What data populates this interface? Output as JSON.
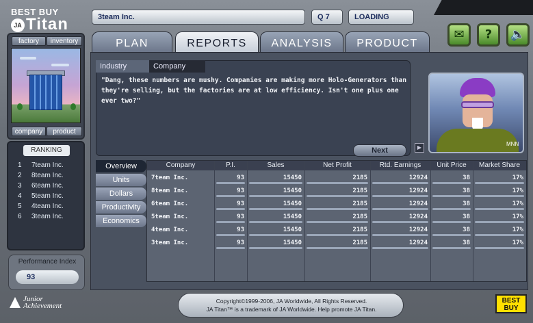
{
  "brand": {
    "store": "BEST BUY",
    "ja_badge": "JA",
    "product": "Titan"
  },
  "left_tabs": {
    "factory": "factory",
    "inventory": "inventory",
    "company": "company",
    "product": "product"
  },
  "ranking": {
    "title": "RANKING",
    "items": [
      {
        "n": "1",
        "name": "7team Inc."
      },
      {
        "n": "2",
        "name": "8team Inc."
      },
      {
        "n": "3",
        "name": "6team Inc."
      },
      {
        "n": "4",
        "name": "5team Inc."
      },
      {
        "n": "5",
        "name": "4team Inc."
      },
      {
        "n": "6",
        "name": "3team Inc."
      }
    ]
  },
  "performance": {
    "label": "Performance Index",
    "value": "93"
  },
  "topbar": {
    "company": "3team Inc.",
    "quarter": "Q 7",
    "status": "LOADING"
  },
  "icons": {
    "mail": "mail-icon",
    "help": "help-icon",
    "sound": "speaker-icon"
  },
  "main_tabs": [
    "PLAN",
    "REPORTS",
    "ANALYSIS",
    "PRODUCT"
  ],
  "sub_tabs": [
    "Industry",
    "Company"
  ],
  "quote": "\"Dang, these numbers are mushy. Companies are making more Holo-Generators than they're selling, but the factories are at low efficiency. Isn't one plus one ever two?\"",
  "next_label": "Next",
  "avatar_tag": "MNN",
  "side_nav": [
    "Overview",
    "Units",
    "Dollars",
    "Productivity",
    "Economics"
  ],
  "table": {
    "headers": [
      "Company",
      "P.I.",
      "Sales",
      "Net Profit",
      "Rtd. Earnings",
      "Unit Price",
      "Market Share"
    ],
    "rows": [
      [
        "7team Inc.",
        "93",
        "15450",
        "2185",
        "12924",
        "38",
        "17%"
      ],
      [
        "8team Inc.",
        "93",
        "15450",
        "2185",
        "12924",
        "38",
        "17%"
      ],
      [
        "6team Inc.",
        "93",
        "15450",
        "2185",
        "12924",
        "38",
        "17%"
      ],
      [
        "5team Inc.",
        "93",
        "15450",
        "2185",
        "12924",
        "38",
        "17%"
      ],
      [
        "4team Inc.",
        "93",
        "15450",
        "2185",
        "12924",
        "38",
        "17%"
      ],
      [
        "3team Inc.",
        "93",
        "15450",
        "2185",
        "12924",
        "38",
        "17%"
      ]
    ]
  },
  "footer": {
    "line1": "Copyright©1999-2006, JA Worldwide, All Rights Reserved.",
    "line2": "JA Titan™ is a trademark of JA Worldwide. Help promote JA Titan.",
    "ja_line1": "Junior",
    "ja_line2": "Achievement",
    "bestbuy_line1": "BEST",
    "bestbuy_line2": "BUY"
  }
}
